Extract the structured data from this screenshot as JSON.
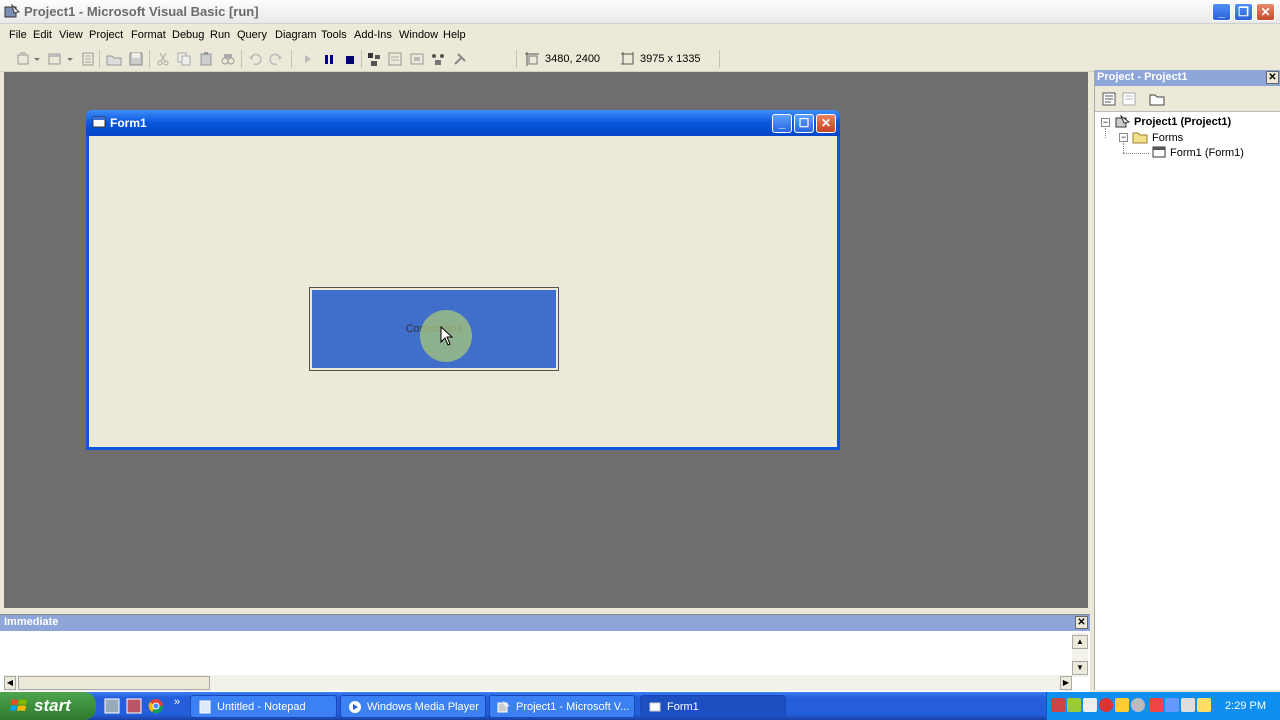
{
  "app": {
    "title": "Project1 - Microsoft Visual Basic [run]"
  },
  "menu": [
    "File",
    "Edit",
    "View",
    "Project",
    "Format",
    "Debug",
    "Run",
    "Query",
    "Diagram",
    "Tools",
    "Add-Ins",
    "Window",
    "Help"
  ],
  "toolbar": {
    "position": "3480, 2400",
    "size": "3975 x 1335"
  },
  "form": {
    "title": "Form1",
    "button_label": "Command1"
  },
  "project_panel": {
    "title": "Project - Project1",
    "tree": {
      "root": "Project1 (Project1)",
      "folder": "Forms",
      "item": "Form1 (Form1)"
    }
  },
  "immediate": {
    "title": "Immediate"
  },
  "taskbar": {
    "start_label": "start",
    "tasks": [
      {
        "label": "Untitled - Notepad"
      },
      {
        "label": "Windows Media Player"
      },
      {
        "label": "Project1 - Microsoft V..."
      },
      {
        "label": "Form1"
      }
    ],
    "clock": "2:29 PM",
    "overflow_glyph": "»"
  },
  "colors": {
    "form_title": "#0856dc",
    "command_button": "#3f6ecb",
    "panel_header": "#8da5d9",
    "taskbar": "#245edb",
    "start_green": "#3c8f3c",
    "mdi_background": "#6e6e6e"
  }
}
